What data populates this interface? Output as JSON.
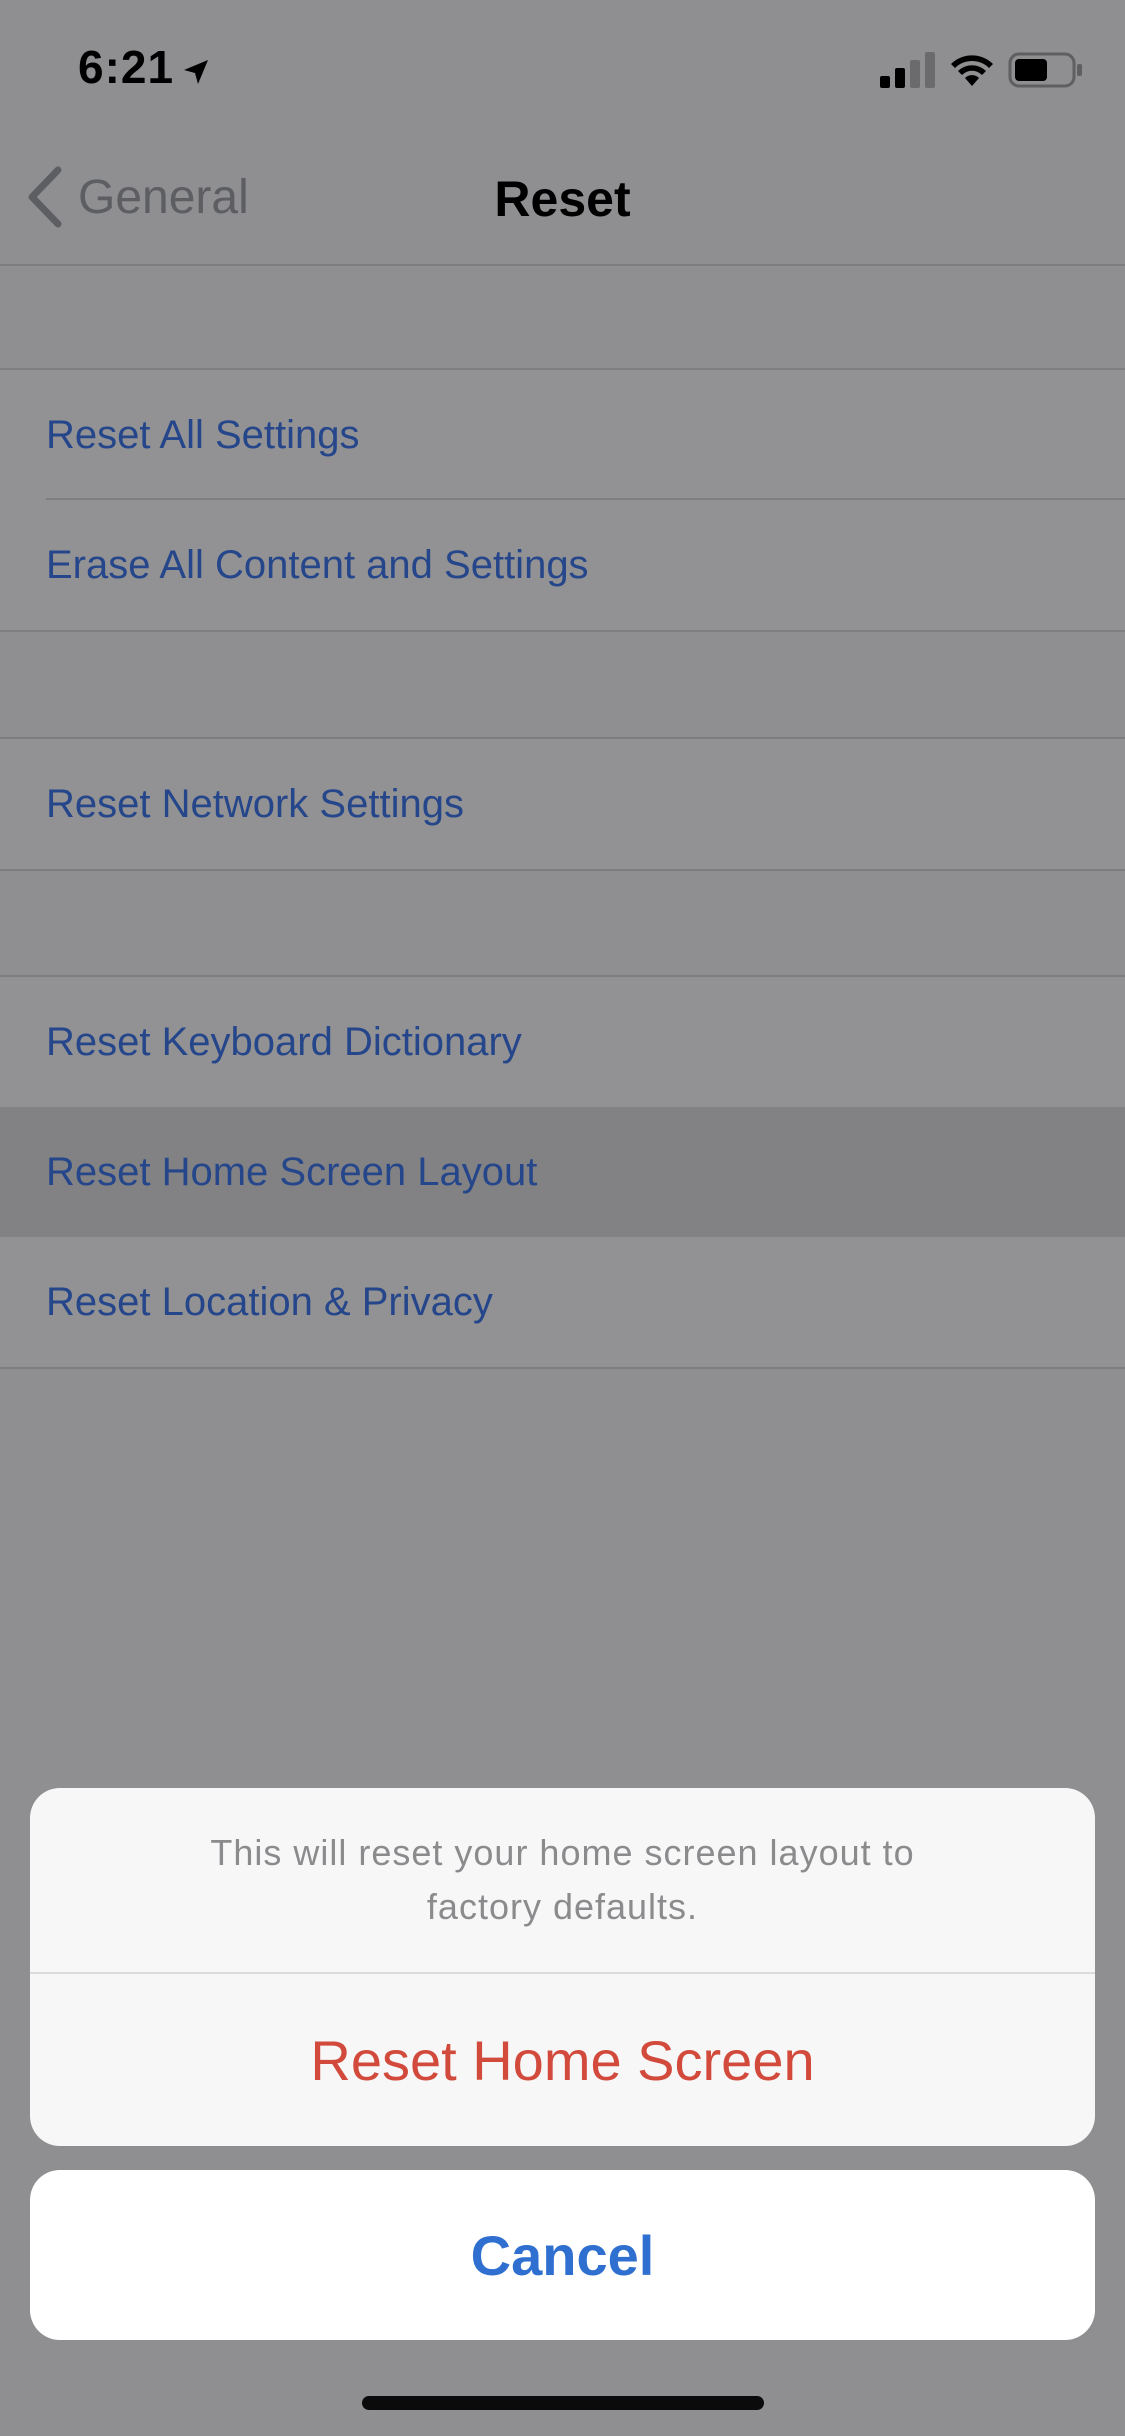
{
  "status_bar": {
    "time": "6:21",
    "icons": [
      "location-arrow-icon",
      "cellular-signal-icon",
      "wifi-icon",
      "battery-icon"
    ]
  },
  "nav": {
    "back_label": "General",
    "title": "Reset"
  },
  "groups": [
    {
      "items": [
        {
          "label": "Reset All Settings"
        },
        {
          "label": "Erase All Content and Settings"
        }
      ]
    },
    {
      "items": [
        {
          "label": "Reset Network Settings"
        }
      ]
    },
    {
      "items": [
        {
          "label": "Reset Keyboard Dictionary"
        },
        {
          "label": "Reset Home Screen Layout",
          "highlighted": true
        },
        {
          "label": "Reset Location & Privacy"
        }
      ]
    }
  ],
  "action_sheet": {
    "message": "This will reset your home screen layout to factory defaults.",
    "destructive_label": "Reset Home Screen",
    "cancel_label": "Cancel"
  },
  "colors": {
    "link_blue": "#25468a",
    "destructive_red": "#d24a3c",
    "cancel_blue": "#2f6fd0",
    "dim_background": "#8f8f91"
  }
}
